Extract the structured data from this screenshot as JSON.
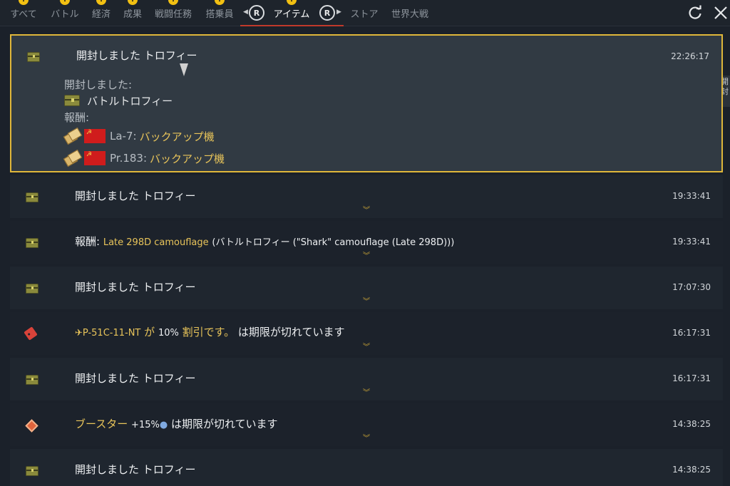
{
  "tabs": [
    {
      "label": "すべて",
      "alert": true,
      "active": false
    },
    {
      "label": "バトル",
      "alert": true,
      "active": false
    },
    {
      "label": "経済",
      "alert": true,
      "active": false
    },
    {
      "label": "成果",
      "alert": true,
      "active": false
    },
    {
      "label": "戦闘任務",
      "alert": true,
      "active": false
    },
    {
      "label": "搭乗員",
      "alert": true,
      "active": false
    },
    {
      "label": "アイテム",
      "alert": true,
      "active": true
    },
    {
      "label": "ストア",
      "alert": false,
      "active": false
    },
    {
      "label": "世界大戦",
      "alert": false,
      "active": false
    }
  ],
  "alert_mark": "!",
  "r_button_label": "R",
  "side_tab_text": "開封",
  "entries": [
    {
      "headline": "開封しました トロフィー",
      "time": "22:26:17",
      "expanded": {
        "opened_label": "開封しました:",
        "trophy_name": "バトルトロフィー",
        "reward_label": "報酬:",
        "rewards": [
          {
            "vehicle": "La-7",
            "sep": ":",
            "item": "バックアップ機"
          },
          {
            "vehicle": "Pr.183",
            "sep": ":",
            "item": "バックアップ機"
          }
        ]
      }
    },
    {
      "headline": "開封しました トロフィー",
      "time": "19:33:41"
    },
    {
      "headline_parts": {
        "label": "報酬:",
        "item": "Late 298D camouflage",
        "detail": "(バトルトロフィー (\"Shark\" camouflage (Late 298D)))"
      },
      "time": "19:33:41"
    },
    {
      "headline": "開封しました トロフィー",
      "time": "17:07:30"
    },
    {
      "headline_parts": {
        "vehicle": "P-51C-11-NT",
        "ga": "が",
        "percent": "10%",
        "discount": "割引です。",
        "expired": "は期限が切れています"
      },
      "time": "16:17:31"
    },
    {
      "headline": "開封しました トロフィー",
      "time": "16:17:31"
    },
    {
      "headline_parts": {
        "booster": "ブースター",
        "bonus": "+15%",
        "expired": "は期限が切れています"
      },
      "time": "14:38:25"
    },
    {
      "headline": "開封しました トロフィー",
      "time": "14:38:25"
    }
  ],
  "expand_glyph": "︾",
  "icons": {
    "trophy": "trophy-chest-icon",
    "discount": "discount-tag-icon",
    "booster": "booster-icon",
    "refresh": "refresh-icon",
    "close": "close-icon",
    "nation": "ussr-flag-icon",
    "reward_ticket": "backup-ticket-icon"
  },
  "colors": {
    "accent_gold": "#e8c45a",
    "expanded_border": "#e0b73a",
    "active_tab_underline": "#c0392b",
    "alert": "#f2c012"
  }
}
